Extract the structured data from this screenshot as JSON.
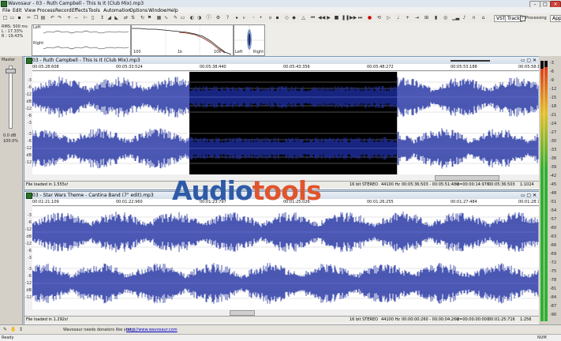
{
  "window": {
    "title": "Wavosaur - 03 - Ruth Campbell - This Is It (Club Mix).mp3"
  },
  "menu": [
    "File",
    "Edit",
    "View",
    "Process",
    "Record",
    "Effects",
    "Tools",
    "Automation",
    "Options",
    "Window",
    "Help"
  ],
  "toolbar": {
    "vst_label": "VST",
    "track_label": "Track",
    "processing_label": "Processing",
    "apply_label": "Apply"
  },
  "analyzer": {
    "rms_line1": "RMS: 500 ms",
    "rms_line2": "L : 17.33%",
    "rms_line3": "R : 19.43%",
    "left_label": "Left",
    "right_label": "Right",
    "scope_left": "Left",
    "scope_right": "Right",
    "spec_ticks": [
      "100",
      "1k",
      "10k"
    ]
  },
  "master": {
    "label": "Master",
    "db": "0.0 dB",
    "pct": "100.0%"
  },
  "doc1": {
    "title": "03 - Ruth Campbell - This Is It (Club Mix).mp3",
    "ruler": [
      "00:05:28:608",
      "00:05:33:524",
      "00:05:38:440",
      "00:05:43:356",
      "00:05:48:272",
      "00:05:53:188",
      "00:05:58:104"
    ],
    "scale_top": [
      "-3",
      "-6",
      "-12",
      "dB",
      "-12",
      "-6",
      "-3"
    ],
    "scale_bot": [
      "-3",
      "-6",
      "-12",
      "dB",
      "-12",
      "-6",
      "-3"
    ],
    "status": {
      "loaded": "File loaded in 1.555s!",
      "bits": "16 bit",
      "mode": "STEREO",
      "rate": "44100 Hz",
      "range": "00:05:36:503 - 00:05:51:480",
      "duration": "d=00:00:14:976",
      "pos": "00:05:36:503",
      "zoom": "1:1024"
    },
    "selection": {
      "start": 0.31,
      "end": 0.72
    }
  },
  "doc2": {
    "title": "03 - Star Wars Theme - Cantina Band (7\" edit).mp3",
    "ruler": [
      "00:01:21:109",
      "00:01:22:960",
      "00:01:23:797",
      "00:01:25:026",
      "00:01:26:255",
      "00:01:27:484",
      "00:01:28:713"
    ],
    "scale_top": [
      "-3",
      "-6",
      "-12",
      "dB",
      "-12",
      "-6",
      "-3"
    ],
    "scale_bot": [
      "-3",
      "-6",
      "-12",
      "dB",
      "-12",
      "-6",
      "-3"
    ],
    "status": {
      "loaded": "File loaded in 1.292s!",
      "bits": "16 bit",
      "mode": "STEREO",
      "rate": "44100 Hz",
      "range": "00:00:00:260 - 00:00:04:260",
      "duration": "d=00:00:00:000",
      "pos": "00:01:25:716",
      "zoom": "1:256"
    }
  },
  "vu_scale": [
    "-3",
    "-6",
    "-9",
    "-12",
    "-15",
    "-18",
    "-21",
    "-24",
    "-27",
    "-30",
    "-33",
    "-36",
    "-39",
    "-42",
    "-45",
    "-48",
    "-51",
    "-54",
    "-57",
    "-60",
    "-63",
    "-66",
    "-69",
    "-72",
    "-75",
    "-78",
    "-81",
    "-84",
    "-87",
    "-90"
  ],
  "bottom": {
    "donate": "Wavosaur needs donators like you :)",
    "url": "http://www.wavosaur.com"
  },
  "statusbar": {
    "left": "Ready",
    "right": "NUM"
  },
  "logo": {
    "part1": "Audio",
    "part2": "tools"
  }
}
